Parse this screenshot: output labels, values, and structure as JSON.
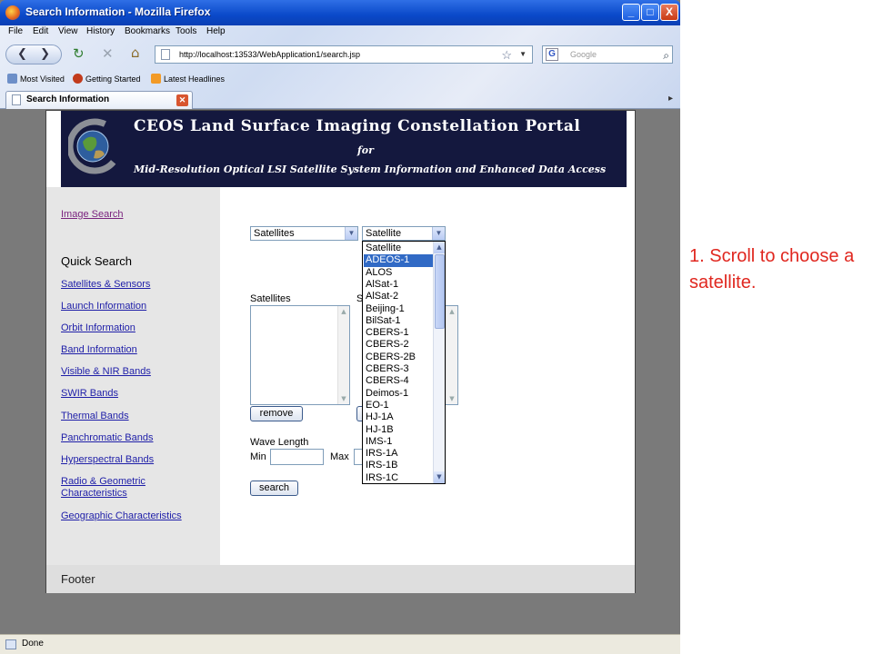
{
  "window": {
    "title": "Search Information - Mozilla Firefox",
    "controls": [
      "_",
      "□",
      "X"
    ]
  },
  "menu": [
    "File",
    "Edit",
    "View",
    "History",
    "Bookmarks",
    "Tools",
    "Help"
  ],
  "toolbar": {
    "url": "http://localhost:13533/WebApplication1/search.jsp",
    "search_engine": "G",
    "search_placeholder": "Google"
  },
  "bookmarks": [
    "Most Visited",
    "Getting Started",
    "Latest Headlines"
  ],
  "tab": {
    "label": "Search Information"
  },
  "banner": {
    "line1": "CEOS Land Surface Imaging Constellation Portal",
    "line2": "for",
    "line3": "Mid-Resolution Optical LSI Satellite System Information and Enhanced Data Access"
  },
  "sidebar": {
    "image_search": "Image Search",
    "quick_search": "Quick Search",
    "links": [
      "Satellites & Sensors",
      "Launch Information",
      "Orbit Information",
      "Band Information",
      "Visible & NIR Bands",
      "SWIR Bands",
      "Thermal Bands",
      "Panchromatic Bands",
      "Hyperspectral Bands",
      "Radio & Geometric Characteristics",
      "Geographic Characteristics"
    ]
  },
  "form": {
    "category_select": "Satellites",
    "item_select": "Satellite",
    "satellites_label": "Satellites",
    "second_list_label_partial": "S",
    "remove_button": "remove",
    "wave_length_label": "Wave Length",
    "min_label": "Min",
    "max_label": "Max",
    "search_button": "search"
  },
  "dropdown": {
    "selected": "ADEOS-1",
    "options": [
      "Satellite",
      "ADEOS-1",
      "ALOS",
      "AlSat-1",
      "AlSat-2",
      "Beijing-1",
      "BilSat-1",
      "CBERS-1",
      "CBERS-2",
      "CBERS-2B",
      "CBERS-3",
      "CBERS-4",
      "Deimos-1",
      "EO-1",
      "HJ-1A",
      "HJ-1B",
      "IMS-1",
      "IRS-1A",
      "IRS-1B",
      "IRS-1C"
    ]
  },
  "footer": {
    "text": "Footer"
  },
  "status": {
    "text": "Done"
  },
  "caption": {
    "text": "1. Scroll to choose a satellite."
  },
  "colors": {
    "banner_bg": "#14183e",
    "selection": "#316ac5",
    "caption": "#e0271f"
  }
}
